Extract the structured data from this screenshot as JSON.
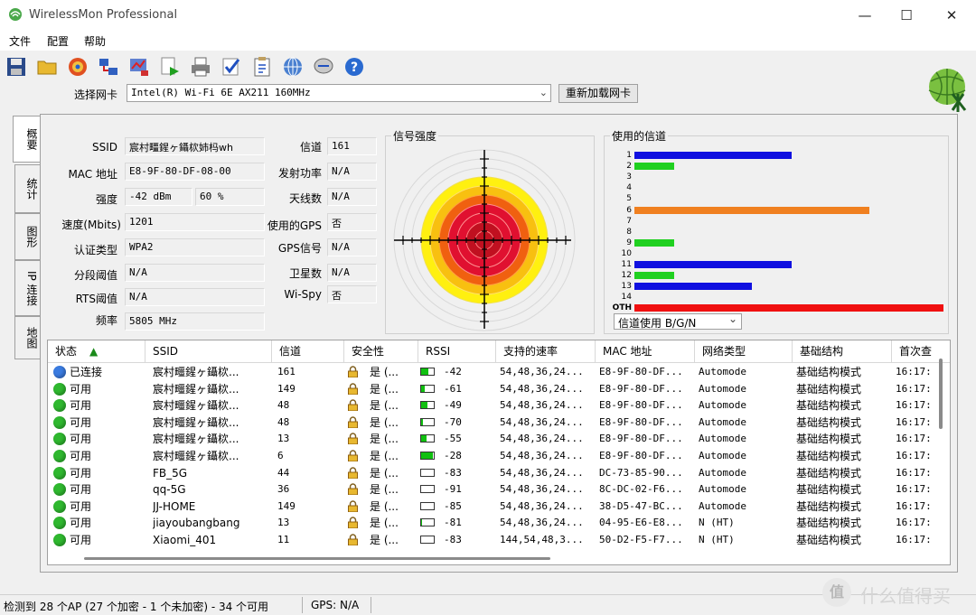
{
  "window": {
    "title": "WirelessMon Professional",
    "minimize": "—",
    "maximize": "☐",
    "close": "✕"
  },
  "menu": [
    "文件",
    "配置",
    "帮助"
  ],
  "toolbar_icons": [
    "save-icon",
    "open-folder-icon",
    "target-icon",
    "network-icon",
    "graph-icon",
    "run-icon",
    "print-icon",
    "check-icon",
    "clipboard-icon",
    "globe-icon",
    "chat-icon",
    "help-icon"
  ],
  "adapter": {
    "label": "选择网卡",
    "value": "Intel(R) Wi-Fi 6E AX211 160MHz",
    "reload": "重新加载网卡"
  },
  "tabs": [
    "概要",
    "统计",
    "图形",
    "IP 连接",
    "地图"
  ],
  "summary": {
    "ssid_label": "SSID",
    "ssid_value": "宸村疅鍟ヶ鑷栨姉杩wh",
    "mac_label": "MAC 地址",
    "mac_value": "E8-9F-80-DF-08-00",
    "strength_label": "强度",
    "strength_dbm": "-42 dBm",
    "strength_pct": "60 %",
    "speed_label": "速度(Mbits)",
    "speed_value": "1201",
    "auth_label": "认证类型",
    "auth_value": "WPA2",
    "frag_label": "分段阈值",
    "frag_value": "N/A",
    "rts_label": "RTS阈值",
    "rts_value": "N/A",
    "freq_label": "频率",
    "freq_value": "5805 MHz",
    "channel_label": "信道",
    "channel_value": "161",
    "txpower_label": "发射功率",
    "txpower_value": "N/A",
    "antenna_label": "天线数",
    "antenna_value": "N/A",
    "gps_used_label": "使用的GPS",
    "gps_used_value": "否",
    "gps_signal_label": "GPS信号",
    "gps_signal_value": "N/A",
    "satellites_label": "卫星数",
    "satellites_value": "N/A",
    "wispy_label": "Wi-Spy",
    "wispy_value": "否"
  },
  "signal_panel": {
    "title": "信号强度"
  },
  "channels_panel": {
    "title": "使用的信道",
    "select_value": "信道使用 B/G/N",
    "select_arrow": "⌄",
    "rows": [
      {
        "label": "1",
        "value": 0.51,
        "color": "#1010e0"
      },
      {
        "label": "2",
        "value": 0.13,
        "color": "#20d020"
      },
      {
        "label": "3",
        "value": 0,
        "color": "#000"
      },
      {
        "label": "4",
        "value": 0,
        "color": "#000"
      },
      {
        "label": "5",
        "value": 0,
        "color": "#000"
      },
      {
        "label": "6",
        "value": 0.76,
        "color": "#f08020"
      },
      {
        "label": "7",
        "value": 0,
        "color": "#000"
      },
      {
        "label": "8",
        "value": 0,
        "color": "#000"
      },
      {
        "label": "9",
        "value": 0.13,
        "color": "#20d020"
      },
      {
        "label": "10",
        "value": 0,
        "color": "#000"
      },
      {
        "label": "11",
        "value": 0.51,
        "color": "#1010e0"
      },
      {
        "label": "12",
        "value": 0.13,
        "color": "#20d020"
      },
      {
        "label": "13",
        "value": 0.38,
        "color": "#1010e0"
      },
      {
        "label": "14",
        "value": 0,
        "color": "#000"
      },
      {
        "label": "OTH",
        "value": 1.0,
        "color": "#f01010"
      }
    ]
  },
  "table": {
    "headers": [
      "状态",
      "SSID",
      "信道",
      "安全性",
      "RSSI",
      "支持的速率",
      "MAC 地址",
      "网络类型",
      "基础结构",
      "首次查"
    ],
    "sort_icon": "▲",
    "rows": [
      {
        "status": "已连接",
        "dot": "#3a7be0",
        "ssid": "宸村疅鍟ヶ鑷栨...",
        "channel": "161",
        "security": "是 (...",
        "rssi": "-42",
        "rssi_level": 0.6,
        "rates": "54,48,36,24...",
        "mac": "E8-9F-80-DF...",
        "nettype": "Automode",
        "infra": "基础结构模式",
        "first": "16:17:"
      },
      {
        "status": "可用",
        "dot": "#2fb82f",
        "ssid": "宸村疅鍟ヶ鑷栨...",
        "channel": "149",
        "security": "是 (...",
        "rssi": "-61",
        "rssi_level": 0.3,
        "rates": "54,48,36,24...",
        "mac": "E8-9F-80-DF...",
        "nettype": "Automode",
        "infra": "基础结构模式",
        "first": "16:17:"
      },
      {
        "status": "可用",
        "dot": "#2fb82f",
        "ssid": "宸村疅鍟ヶ鑷栨...",
        "channel": "48",
        "security": "是 (...",
        "rssi": "-49",
        "rssi_level": 0.5,
        "rates": "54,48,36,24...",
        "mac": "E8-9F-80-DF...",
        "nettype": "Automode",
        "infra": "基础结构模式",
        "first": "16:17:"
      },
      {
        "status": "可用",
        "dot": "#2fb82f",
        "ssid": "宸村疅鍟ヶ鑷栨...",
        "channel": "48",
        "security": "是 (...",
        "rssi": "-70",
        "rssi_level": 0.15,
        "rates": "54,48,36,24...",
        "mac": "E8-9F-80-DF...",
        "nettype": "Automode",
        "infra": "基础结构模式",
        "first": "16:17:"
      },
      {
        "status": "可用",
        "dot": "#2fb82f",
        "ssid": "宸村疅鍟ヶ鑷栨...",
        "channel": "13",
        "security": "是 (...",
        "rssi": "-55",
        "rssi_level": 0.45,
        "rates": "54,48,36,24...",
        "mac": "E8-9F-80-DF...",
        "nettype": "Automode",
        "infra": "基础结构模式",
        "first": "16:17:"
      },
      {
        "status": "可用",
        "dot": "#2fb82f",
        "ssid": "宸村疅鍟ヶ鑷栨...",
        "channel": "6",
        "security": "是 (...",
        "rssi": "-28",
        "rssi_level": 0.9,
        "rates": "54,48,36,24...",
        "mac": "E8-9F-80-DF...",
        "nettype": "Automode",
        "infra": "基础结构模式",
        "first": "16:17:"
      },
      {
        "status": "可用",
        "dot": "#2fb82f",
        "ssid": "FB_5G",
        "channel": "44",
        "security": "是 (...",
        "rssi": "-83",
        "rssi_level": 0,
        "rates": "54,48,36,24...",
        "mac": "DC-73-85-90...",
        "nettype": "Automode",
        "infra": "基础结构模式",
        "first": "16:17:"
      },
      {
        "status": "可用",
        "dot": "#2fb82f",
        "ssid": "qq-5G",
        "channel": "36",
        "security": "是 (...",
        "rssi": "-91",
        "rssi_level": 0,
        "rates": "54,48,36,24...",
        "mac": "8C-DC-02-F6...",
        "nettype": "Automode",
        "infra": "基础结构模式",
        "first": "16:17:"
      },
      {
        "status": "可用",
        "dot": "#2fb82f",
        "ssid": "JJ-HOME",
        "channel": "149",
        "security": "是 (...",
        "rssi": "-85",
        "rssi_level": 0,
        "rates": "54,48,36,24...",
        "mac": "38-D5-47-BC...",
        "nettype": "Automode",
        "infra": "基础结构模式",
        "first": "16:17:"
      },
      {
        "status": "可用",
        "dot": "#2fb82f",
        "ssid": "jiayoubangbang",
        "channel": "13",
        "security": "是 (...",
        "rssi": "-81",
        "rssi_level": 0.05,
        "rates": "54,48,36,24...",
        "mac": "04-95-E6-E8...",
        "nettype": "N (HT)",
        "infra": "基础结构模式",
        "first": "16:17:"
      },
      {
        "status": "可用",
        "dot": "#2fb82f",
        "ssid": "Xiaomi_401",
        "channel": "11",
        "security": "是 (...",
        "rssi": "-83",
        "rssi_level": 0,
        "rates": "144,54,48,3...",
        "mac": "50-D2-F5-F7...",
        "nettype": "N (HT)",
        "infra": "基础结构模式",
        "first": "16:17:"
      }
    ]
  },
  "statusbar": {
    "ap_summary": "检测到 28 个AP (27 个加密 - 1 个未加密) - 34 个可用",
    "gps": "GPS: N/A"
  },
  "watermark": {
    "text": "什么值得买",
    "badge": "值"
  }
}
